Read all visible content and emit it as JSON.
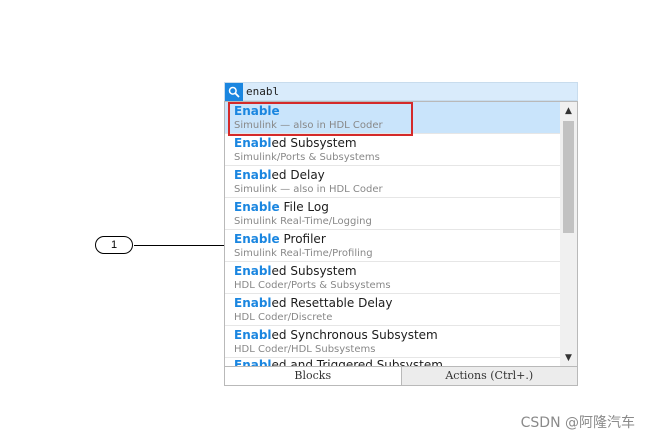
{
  "search": {
    "query": "enabl"
  },
  "results": [
    {
      "match": "Enable",
      "rest": "",
      "library": "Simulink — also in HDL Coder",
      "selected": true
    },
    {
      "match": "Enabl",
      "rest": "ed Subsystem",
      "library": "Simulink/Ports & Subsystems"
    },
    {
      "match": "Enabl",
      "rest": "ed Delay",
      "library": "Simulink — also in HDL Coder"
    },
    {
      "match": "Enable",
      "rest": " File Log",
      "library": "Simulink Real-Time/Logging"
    },
    {
      "match": "Enable",
      "rest": " Profiler",
      "library": "Simulink Real-Time/Profiling"
    },
    {
      "match": "Enabl",
      "rest": "ed Subsystem",
      "library": "HDL Coder/Ports & Subsystems"
    },
    {
      "match": "Enabl",
      "rest": "ed Resettable Delay",
      "library": "HDL Coder/Discrete"
    },
    {
      "match": "Enabl",
      "rest": "ed Synchronous Subsystem",
      "library": "HDL Coder/HDL Subsystems"
    },
    {
      "match": "Enabl",
      "rest": "ed and Triggered Subsystem",
      "library": ""
    }
  ],
  "tabs": {
    "blocks": "Blocks",
    "actions": "Actions (Ctrl+.)"
  },
  "callout": {
    "number": "1"
  },
  "watermark": "CSDN @阿隆汽车",
  "colors": {
    "accent": "#1a86e0",
    "selection": "#c9e4fb",
    "highlight_border": "#d42a2a"
  }
}
